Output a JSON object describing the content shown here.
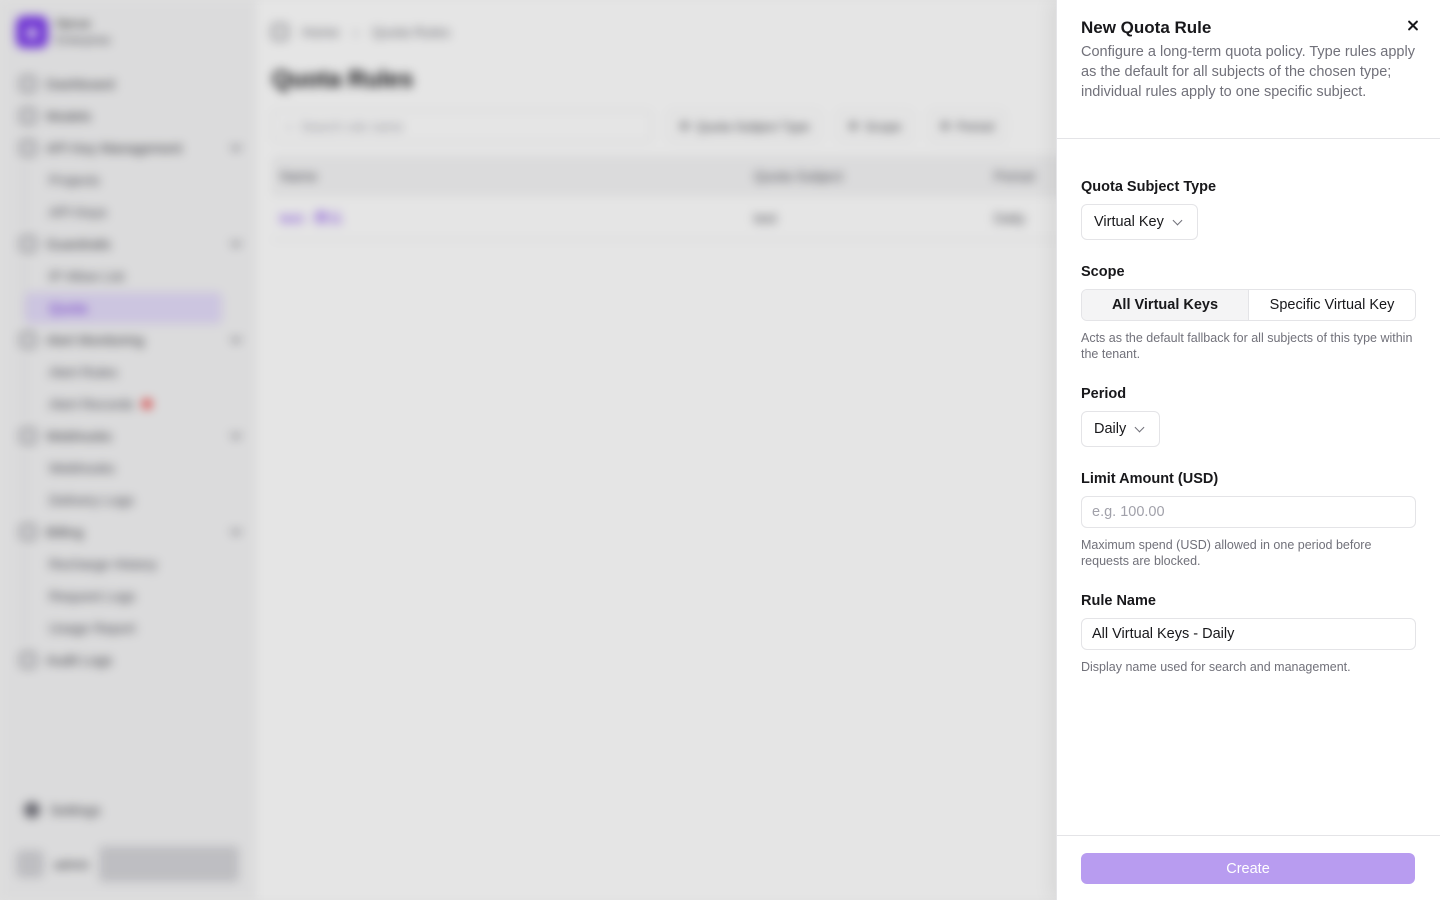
{
  "brand": {
    "name": "Nerve",
    "plan": "Enterprise"
  },
  "sidebar": {
    "items": [
      {
        "label": "Dashboard"
      },
      {
        "label": "Models"
      },
      {
        "label": "API Key Management",
        "children": [
          "Projects",
          "API Keys"
        ]
      },
      {
        "label": "Guardrails",
        "children": [
          "IP Allow List",
          "Quota"
        ]
      },
      {
        "label": "Alert Monitoring",
        "children": [
          "Alert Rules",
          "Alert Records"
        ]
      },
      {
        "label": "Webhooks",
        "children": [
          "Webhooks",
          "Delivery Logs"
        ]
      },
      {
        "label": "Billing",
        "children": [
          "Recharge History",
          "Request Logs",
          "Usage Report"
        ]
      },
      {
        "label": "Audit Logs"
      }
    ],
    "settings_label": "Settings",
    "user_name": "admin"
  },
  "header": {
    "breadcrumb_home": "Home",
    "breadcrumb_current": "Quota Rules"
  },
  "main": {
    "title": "Quota Rules",
    "search_placeholder": "Search rule name",
    "filters": [
      "Quota Subject Type",
      "Scope",
      "Period"
    ],
    "table": {
      "headers": [
        "Name",
        "Quota Subject",
        "Period"
      ],
      "rows": [
        [
          "test - 默认",
          "test",
          "Daily"
        ]
      ]
    }
  },
  "drawer": {
    "title": "New Quota Rule",
    "description": "Configure a long-term quota policy. Type rules apply as the default for all subjects of the chosen type; individual rules apply to one specific subject.",
    "subject_type": {
      "label": "Quota Subject Type",
      "value": "Virtual Key"
    },
    "scope": {
      "label": "Scope",
      "options": [
        "All Virtual Keys",
        "Specific Virtual Key"
      ],
      "selected": "All Virtual Keys",
      "hint": "Acts as the default fallback for all subjects of this type within the tenant."
    },
    "period": {
      "label": "Period",
      "value": "Daily"
    },
    "limit": {
      "label": "Limit Amount (USD)",
      "placeholder": "e.g. 100.00",
      "value": "",
      "hint": "Maximum spend (USD) allowed in one period before requests are blocked."
    },
    "rule_name": {
      "label": "Rule Name",
      "value": "All Virtual Keys - Daily",
      "hint": "Display name used for search and management."
    },
    "create_label": "Create"
  },
  "colors": {
    "accent": "#7c3aed",
    "create_button": "#b89cf0",
    "border": "#e4e4e7",
    "muted_text": "#71717a"
  }
}
